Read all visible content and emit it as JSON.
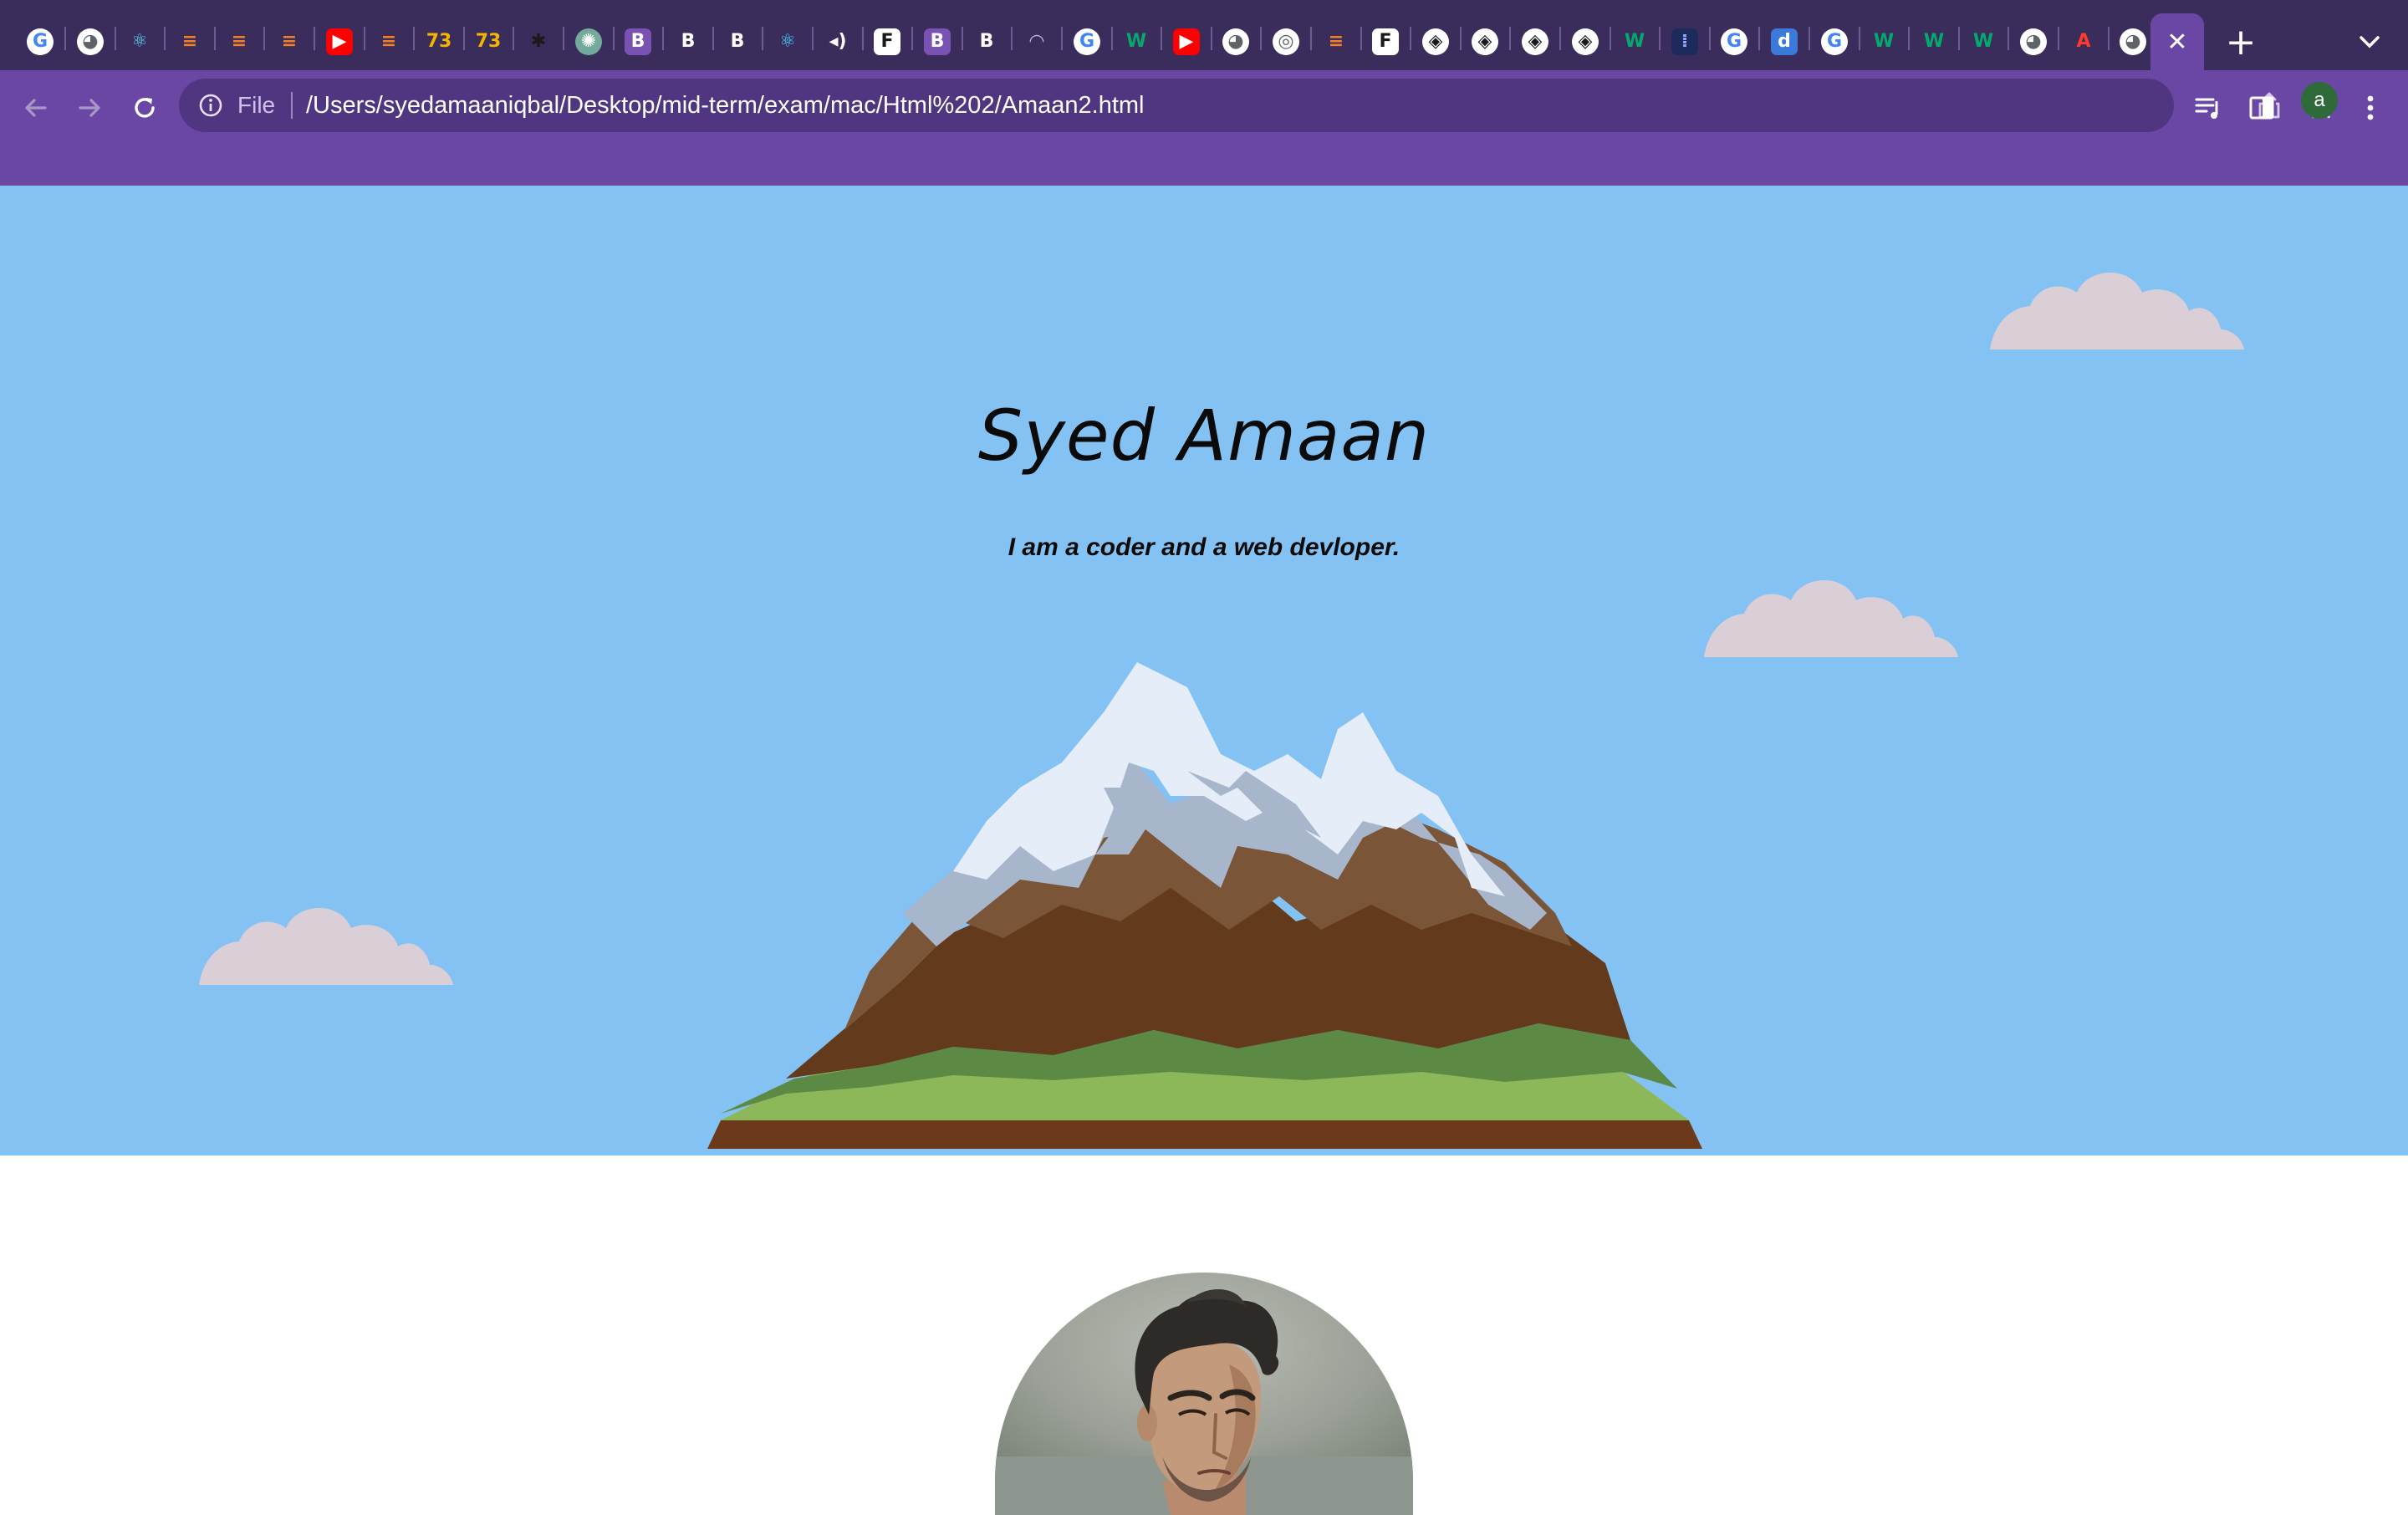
{
  "browser": {
    "tabs": [
      {
        "icon": "google-icon",
        "fav": "G",
        "bg": "#ffffff",
        "fg": "#4285f4",
        "round": true
      },
      {
        "icon": "globe-icon",
        "fav": "◕",
        "bg": "#ffffff",
        "fg": "#5f6368",
        "round": true
      },
      {
        "icon": "react-icon",
        "fav": "⚛",
        "bg": "transparent",
        "fg": "#61dafb",
        "round": false
      },
      {
        "icon": "stackoverflow-icon",
        "fav": "≡",
        "bg": "transparent",
        "fg": "#f48024",
        "round": false
      },
      {
        "icon": "stackoverflow-icon",
        "fav": "≡",
        "bg": "transparent",
        "fg": "#f48024",
        "round": false
      },
      {
        "icon": "stackoverflow-icon",
        "fav": "≡",
        "bg": "transparent",
        "fg": "#f48024",
        "round": false
      },
      {
        "icon": "youtube-icon",
        "fav": "▶",
        "bg": "#ff0000",
        "fg": "#ffffff",
        "round": false
      },
      {
        "icon": "stackoverflow-icon",
        "fav": "≡",
        "bg": "transparent",
        "fg": "#f48024",
        "round": false
      },
      {
        "icon": "w3schools-icon",
        "fav": "73",
        "bg": "transparent",
        "fg": "#f4b400",
        "round": false
      },
      {
        "icon": "w3schools-icon",
        "fav": "73",
        "bg": "transparent",
        "fg": "#f4b400",
        "round": false
      },
      {
        "icon": "gear-dark-icon",
        "fav": "✱",
        "bg": "transparent",
        "fg": "#1a1a1a",
        "round": false
      },
      {
        "icon": "openai-icon",
        "fav": "✺",
        "bg": "#74aa9c",
        "fg": "#ffffff",
        "round": true
      },
      {
        "icon": "bootstrap-icon",
        "fav": "B",
        "bg": "#7952b3",
        "fg": "#ffffff",
        "round": false
      },
      {
        "icon": "bootstrap-icon",
        "fav": "B",
        "bg": "transparent",
        "fg": "#ffffff",
        "round": false
      },
      {
        "icon": "bootstrap-icon",
        "fav": "B",
        "bg": "transparent",
        "fg": "#ffffff",
        "round": false
      },
      {
        "icon": "react-bootstrap-icon",
        "fav": "⚛",
        "bg": "transparent",
        "fg": "#41e0fd",
        "round": false
      },
      {
        "icon": "audio-icon",
        "fav": "◂)",
        "bg": "transparent",
        "fg": "#ffffff",
        "round": false
      },
      {
        "icon": "fontawesome-icon",
        "fav": "F",
        "bg": "#ffffff",
        "fg": "#1a1a1a",
        "round": false
      },
      {
        "icon": "bootstrap-icon",
        "fav": "B",
        "bg": "#7952b3",
        "fg": "#ffffff",
        "round": false
      },
      {
        "icon": "bootstrap-icon",
        "fav": "B",
        "bg": "transparent",
        "fg": "#ffffff",
        "round": false
      },
      {
        "icon": "loading-icon",
        "fav": "◠",
        "bg": "transparent",
        "fg": "#c0b4d8",
        "round": false
      },
      {
        "icon": "google-icon",
        "fav": "G",
        "bg": "#ffffff",
        "fg": "#4285f4",
        "round": true
      },
      {
        "icon": "w3-icon",
        "fav": "W",
        "bg": "transparent",
        "fg": "#04aa6d",
        "round": false
      },
      {
        "icon": "youtube-icon",
        "fav": "▶",
        "bg": "#ff0000",
        "fg": "#ffffff",
        "round": false
      },
      {
        "icon": "globe-icon",
        "fav": "◕",
        "bg": "#ffffff",
        "fg": "#5f6368",
        "round": true
      },
      {
        "icon": "chrome-icon",
        "fav": "◎",
        "bg": "#ffffff",
        "fg": "#5f6368",
        "round": true
      },
      {
        "icon": "stackoverflow-icon",
        "fav": "≡",
        "bg": "transparent",
        "fg": "#f48024",
        "round": false
      },
      {
        "icon": "fontawesome-icon",
        "fav": "F",
        "bg": "#ffffff",
        "fg": "#1a1a1a",
        "round": false
      },
      {
        "icon": "codepen-icon",
        "fav": "◈",
        "bg": "#ffffff",
        "fg": "#1a1a1a",
        "round": true
      },
      {
        "icon": "codepen-icon",
        "fav": "◈",
        "bg": "#ffffff",
        "fg": "#1a1a1a",
        "round": true
      },
      {
        "icon": "codepen-icon",
        "fav": "◈",
        "bg": "#ffffff",
        "fg": "#1a1a1a",
        "round": true
      },
      {
        "icon": "codepen-icon",
        "fav": "◈",
        "bg": "#ffffff",
        "fg": "#1a1a1a",
        "round": true
      },
      {
        "icon": "w3-icon",
        "fav": "W",
        "bg": "transparent",
        "fg": "#04aa6d",
        "round": false
      },
      {
        "icon": "dotted-grid-icon",
        "fav": "⁞",
        "bg": "#1d2a5c",
        "fg": "#8fa8ff",
        "round": false
      },
      {
        "icon": "google-icon",
        "fav": "G",
        "bg": "#ffffff",
        "fg": "#4285f4",
        "round": true
      },
      {
        "icon": "dictionary-icon",
        "fav": "d",
        "bg": "#3b7ad9",
        "fg": "#ffffff",
        "round": false
      },
      {
        "icon": "google-icon",
        "fav": "G",
        "bg": "#ffffff",
        "fg": "#4285f4",
        "round": true
      },
      {
        "icon": "w3-icon",
        "fav": "W",
        "bg": "transparent",
        "fg": "#04aa6d",
        "round": false
      },
      {
        "icon": "w3-icon",
        "fav": "W",
        "bg": "transparent",
        "fg": "#04aa6d",
        "round": false
      },
      {
        "icon": "w3-icon",
        "fav": "W",
        "bg": "transparent",
        "fg": "#04aa6d",
        "round": false
      },
      {
        "icon": "globe-icon",
        "fav": "◕",
        "bg": "#ffffff",
        "fg": "#5f6368",
        "round": true
      },
      {
        "icon": "acrobat-icon",
        "fav": "A",
        "bg": "transparent",
        "fg": "#ff3b30",
        "round": false
      },
      {
        "icon": "globe-icon",
        "fav": "◕",
        "bg": "#ffffff",
        "fg": "#5f6368",
        "round": true
      }
    ],
    "active_tab_close": "✕",
    "new_tab_label": "+",
    "omnibox": {
      "scheme_label": "File",
      "url": "/Users/syedamaaniqbal/Desktop/mid-term/exam/mac/Html%202/Amaan2.html"
    },
    "avatar_initial": "a",
    "colors": {
      "tabstrip": "#3a2c5b",
      "toolbar": "#6a47a4",
      "omnibox": "#503680"
    }
  },
  "page": {
    "hero": {
      "title": "Syed Amaan",
      "subtitle": "I am a coder and a web devloper.",
      "sky_color": "#85c2f4",
      "cloud_color": "#dacfd6"
    }
  }
}
